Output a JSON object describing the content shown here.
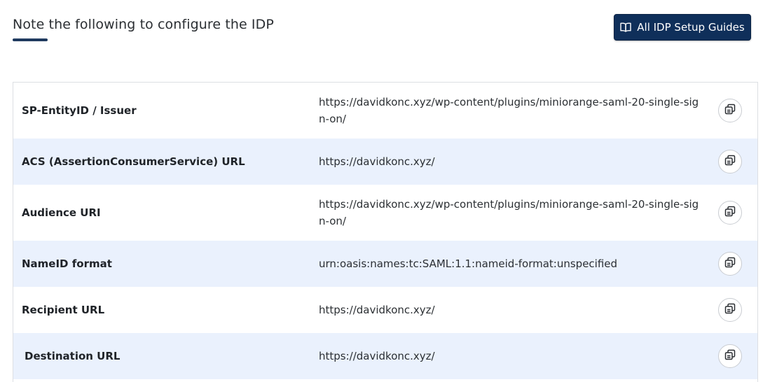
{
  "header": {
    "title": "Note the following to configure the IDP",
    "guides_button": {
      "label": "All IDP Setup Guides",
      "icon": "book-icon"
    }
  },
  "colors": {
    "accent": "#0f2f5a",
    "row_alt": "#eaf1fd"
  },
  "rows": [
    {
      "label": "SP-EntityID / Issuer",
      "value": "https://davidkonc.xyz/wp-content/plugins/miniorange-saml-20-single-sign-on/",
      "copy_icon": "copy-icon"
    },
    {
      "label": "ACS (AssertionConsumerService) URL",
      "value": "https://davidkonc.xyz/",
      "copy_icon": "copy-icon"
    },
    {
      "label": "Audience URI",
      "value": "https://davidkonc.xyz/wp-content/plugins/miniorange-saml-20-single-sign-on/",
      "copy_icon": "copy-icon"
    },
    {
      "label": "NameID format",
      "value": "urn:oasis:names:tc:SAML:1.1:nameid-format:unspecified",
      "copy_icon": "copy-icon"
    },
    {
      "label": "Recipient URL",
      "value": "https://davidkonc.xyz/",
      "copy_icon": "copy-icon"
    },
    {
      "label": "Destination URL",
      "value": "https://davidkonc.xyz/",
      "copy_icon": "copy-icon"
    }
  ]
}
